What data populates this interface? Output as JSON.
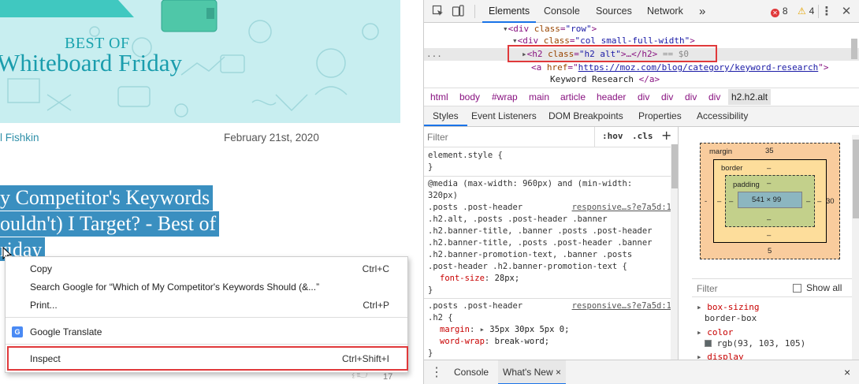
{
  "page": {
    "banner_best": "BEST OF",
    "banner_title": "Whiteboard Friday",
    "author": "l Fishkin",
    "date": "February 21st, 2020",
    "heading_line1": "y Competitor's Keywords",
    "heading_line2": "ouldn't) I Target? - Best of",
    "heading_line3": "riday",
    "side_count": "17"
  },
  "context_menu": {
    "items": [
      {
        "label": "Copy",
        "shortcut": "Ctrl+C"
      },
      {
        "label": "Search Google for “Which of My Competitor's Keywords Should (&...”",
        "shortcut": ""
      },
      {
        "label": "Print...",
        "shortcut": "Ctrl+P"
      },
      {
        "label": "Google Translate",
        "shortcut": "",
        "icon": "google-translate-icon"
      },
      {
        "label": "Inspect",
        "shortcut": "Ctrl+Shift+I"
      }
    ],
    "gt_icon_text": "G"
  },
  "devtools": {
    "tabs": [
      "Elements",
      "Console",
      "Sources",
      "Network"
    ],
    "active_tab": "Elements",
    "more_tabs": "»",
    "errors": "8",
    "warnings": "4",
    "dom": {
      "line1_open": "<div ",
      "line1_attr": "class",
      "line1_val": "\"row\"",
      "line1_close": ">",
      "line2_open": "<div ",
      "line2_attr": "class",
      "line2_val": "\"col small-full-width\"",
      "line2_close": ">",
      "line3_dots": "...",
      "line3_open": "<h2 ",
      "line3_attr": "class",
      "line3_val": "\"h2 alt\"",
      "line3_rest": ">…</h2>",
      "line3_eq": " == $0",
      "line4_open": "<a ",
      "line4_attr": "href",
      "line4_eq": "=\"",
      "line4_link": "https://moz.com/blog/category/keyword-research",
      "line4_close": "\">",
      "line5_text": "Keyword Research ",
      "line5_close": "</a>"
    },
    "breadcrumbs": [
      "html",
      "body",
      "#wrap",
      "main",
      "article",
      "header",
      "div",
      "div",
      "div",
      "div"
    ],
    "breadcrumb_active": "h2.h2.alt",
    "subtabs": [
      "Styles",
      "Event Listeners",
      "DOM Breakpoints",
      "Properties",
      "Accessibility"
    ],
    "active_subtab": "Styles",
    "styles": {
      "filter_placeholder": "Filter",
      "hov": ":hov",
      "cls": ".cls",
      "plus": "+",
      "element_style": "element.style {",
      "element_style_close": "}",
      "media": "@media (max-width: 960px) and (min-width:",
      "media2": "320px)",
      "rule1_sel": [
        ".posts .post-header",
        ".h2.alt, .posts .post-header .banner",
        ".h2.banner-title, .banner .posts .post-header",
        ".h2.banner-title, .posts .post-header .banner",
        ".h2.banner-promotion-text, .banner .posts",
        ".post-header .h2.banner-promotion-text {"
      ],
      "rule1_src": "responsive…s?e7a5d:1",
      "rule1_prop": "font-size",
      "rule1_val": "28px;",
      "rule1_close": "}",
      "rule2_sel1": ".posts .post-header",
      "rule2_sel2": ".h2 {",
      "rule2_src": "responsive…s?e7a5d:1",
      "rule2_prop1": "margin",
      "rule2_val1": "35px 30px 5px 0;",
      "rule2_prop2": "word-wrap",
      "rule2_val2": "break-word;",
      "rule2_close": "}"
    },
    "box_model": {
      "margin_label": "margin",
      "margin_top": "35",
      "margin_right": "30",
      "margin_bottom": "5",
      "margin_left": "-",
      "border_label": "border",
      "border_top": "–",
      "border_right": "–",
      "border_bottom": "–",
      "border_left": "–",
      "padding_label": "padding",
      "padding_top": "–",
      "padding_right": "–",
      "padding_bottom": "–",
      "padding_left": "–",
      "content": "541 × 99"
    },
    "computed": {
      "filter_placeholder": "Filter",
      "show_all": "Show all",
      "props": [
        {
          "name": "box-sizing",
          "value": "border-box"
        },
        {
          "name": "color",
          "value": "rgb(93, 103, 105)"
        },
        {
          "name": "display",
          "value": ""
        }
      ],
      "color_swatch": "#5d6769"
    },
    "drawer_tabs": [
      "Console",
      "What's New"
    ],
    "drawer_close_tab": "×",
    "drawer_close": "×"
  },
  "colors": {
    "accent": "#1a73e8",
    "highlight_border": "#e0393b",
    "selection": "#3a8fc0",
    "banner_bg": "#c8eef0"
  }
}
